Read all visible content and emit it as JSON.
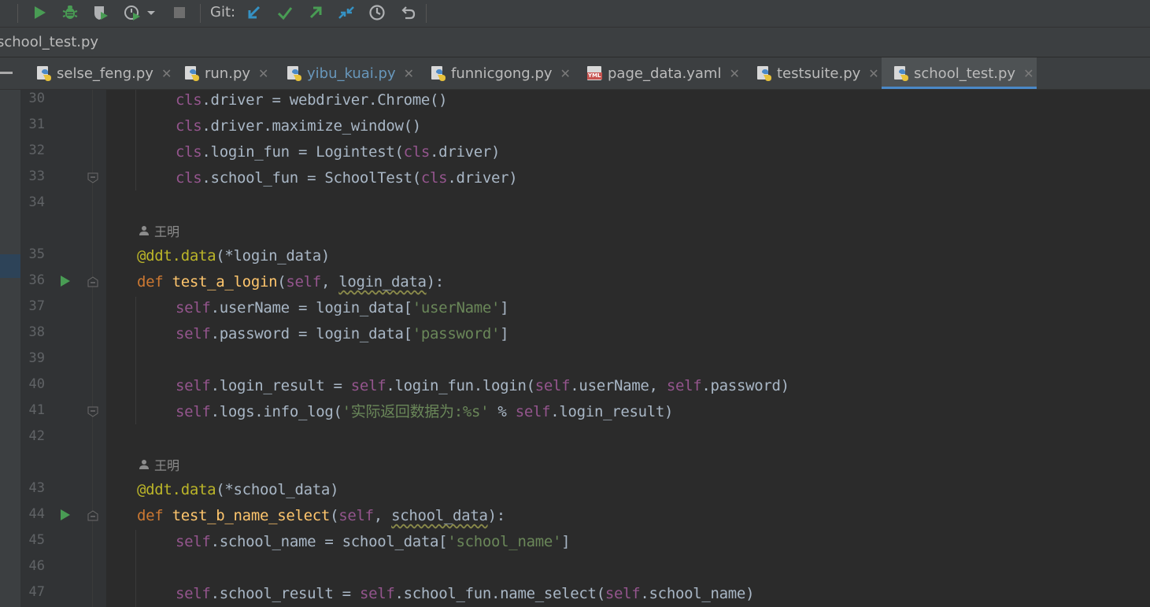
{
  "toolbar": {
    "git_label": "Git:",
    "icons": [
      "run-icon",
      "debug-icon",
      "coverage-icon",
      "profile-icon",
      "dropdown-icon",
      "stop-icon",
      "git-update-icon",
      "git-commit-icon",
      "git-push-icon",
      "git-merge-icon",
      "history-icon",
      "rollback-icon"
    ]
  },
  "breadcrumb": {
    "file": "school_test.py"
  },
  "tabs": [
    {
      "label": "selse_feng.py",
      "icon": "python-file-icon",
      "modified": false,
      "active": false
    },
    {
      "label": "run.py",
      "icon": "python-file-icon",
      "modified": false,
      "active": false
    },
    {
      "label": "yibu_kuai.py",
      "icon": "python-file-icon",
      "modified": true,
      "active": false
    },
    {
      "label": "funnicgong.py",
      "icon": "python-file-icon",
      "modified": false,
      "active": false
    },
    {
      "label": "page_data.yaml",
      "icon": "yaml-file-icon",
      "modified": false,
      "active": false
    },
    {
      "label": "testsuite.py",
      "icon": "python-file-icon",
      "modified": false,
      "active": false
    },
    {
      "label": "school_test.py",
      "icon": "python-file-icon",
      "modified": false,
      "active": true
    }
  ],
  "yaml_badge": "YML",
  "author": "王明",
  "colors": {
    "background": "#2b2b2b",
    "keyword": "#cc7832",
    "self": "#94558d",
    "function": "#ffc66d",
    "string": "#6a8759",
    "decorator": "#bbb529",
    "accent": "#4a88c7"
  },
  "lines": [
    {
      "num": "30",
      "text": "cls.driver = webdriver.Chrome()"
    },
    {
      "num": "31",
      "text": "cls.driver.maximize_window()"
    },
    {
      "num": "32",
      "text": "cls.login_fun = Logintest(cls.driver)"
    },
    {
      "num": "33",
      "text": "cls.school_fun = SchoolTest(cls.driver)"
    },
    {
      "num": "34",
      "text": ""
    },
    {
      "num": "35",
      "text": "@ddt.data(*login_data)"
    },
    {
      "num": "36",
      "text": "def test_a_login(self, login_data):"
    },
    {
      "num": "37",
      "text": "self.userName = login_data['userName']"
    },
    {
      "num": "38",
      "text": "self.password = login_data['password']"
    },
    {
      "num": "39",
      "text": ""
    },
    {
      "num": "40",
      "text": "self.login_result = self.login_fun.login(self.userName, self.password)"
    },
    {
      "num": "41",
      "text": "self.logs.info_log('实际返回数据为:%s' % self.login_result)"
    },
    {
      "num": "42",
      "text": ""
    },
    {
      "num": "43",
      "text": "@ddt.data(*school_data)"
    },
    {
      "num": "44",
      "text": "def test_b_name_select(self, school_data):"
    },
    {
      "num": "45",
      "text": "self.school_name = school_data['school_name']"
    },
    {
      "num": "46",
      "text": ""
    },
    {
      "num": "47",
      "text": "self.school_result = self.school_fun.name_select(self.school_name)"
    }
  ]
}
